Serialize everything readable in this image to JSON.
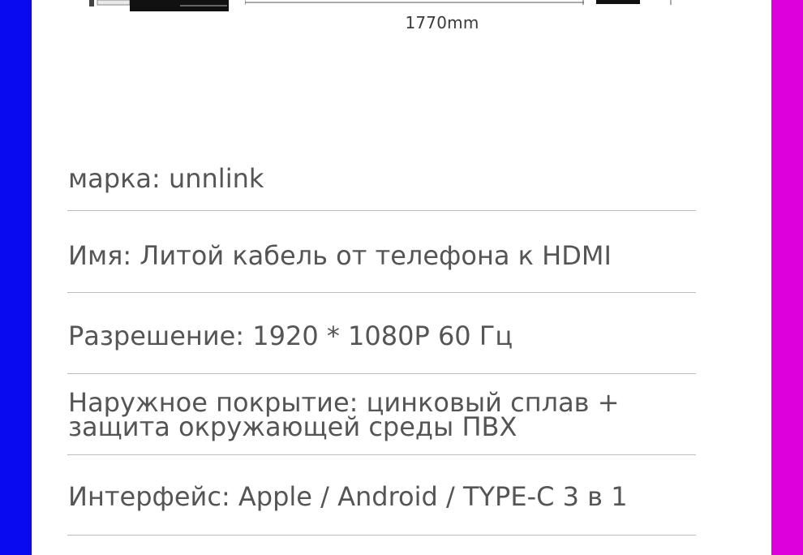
{
  "colors": {
    "left_edge": "#0a0af0",
    "right_edge": "#dd00dd",
    "text": "#555555",
    "divider": "#bdbdbd"
  },
  "drawing": {
    "left_dimension": "17",
    "length_label": "1770mm"
  },
  "specs": [
    {
      "text": "марка: unnlink"
    },
    {
      "text": "Имя: Литой кабель от телефона к HDMI"
    },
    {
      "text": "Разрешение: 1920 * 1080P 60 Гц"
    },
    {
      "text": "Наружное покрытие: цинковый сплав + защита окружающей среды ПВХ"
    },
    {
      "text": "Интерфейс: Apple / Android / TYPE-C 3 в 1"
    }
  ]
}
